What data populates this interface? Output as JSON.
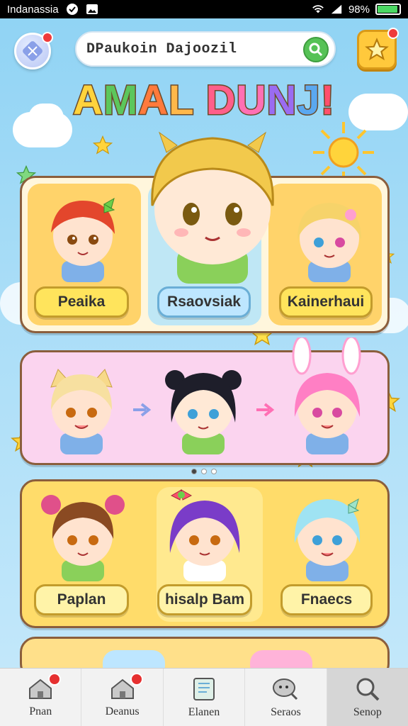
{
  "status_bar": {
    "carrier": "Indanassia",
    "battery_text": "98%",
    "icons": [
      "check-circle-icon",
      "image-icon",
      "wifi-icon",
      "signal-icon",
      "battery-icon"
    ]
  },
  "header": {
    "search_value": "DPaukoin Dajoozil",
    "search_icon": "search-icon",
    "avatar_icon": "avatar-icon",
    "reward_icon": "star-icon"
  },
  "title": {
    "letters": [
      "A",
      "M",
      "A",
      "L",
      " ",
      "D",
      "U",
      "N",
      "J",
      "!"
    ]
  },
  "panel_top": {
    "characters": [
      {
        "label": "Peaika"
      },
      {
        "label": "Rsaovsiak"
      },
      {
        "label": "Kainerhaui"
      }
    ]
  },
  "panel_middle": {
    "characters": [
      "character-blonde-cat",
      "character-black-hair",
      "character-pink-bunny"
    ],
    "page_indicator": {
      "count": 3,
      "active": 0
    }
  },
  "panel_bottom": {
    "characters": [
      {
        "label": "Paplan"
      },
      {
        "label": "hisalp Bam"
      },
      {
        "label": "Fnaecs"
      }
    ]
  },
  "bottom_nav": {
    "items": [
      {
        "label": "Pnan",
        "icon": "home-icon",
        "badge": true
      },
      {
        "label": "Deanus",
        "icon": "home-icon",
        "badge": true
      },
      {
        "label": "Elanen",
        "icon": "book-icon",
        "badge": false
      },
      {
        "label": "Seraos",
        "icon": "chat-search-icon",
        "badge": false
      },
      {
        "label": "Senop",
        "icon": "search-icon",
        "badge": false
      }
    ],
    "active_index": 4
  },
  "colors": {
    "sky": "#8fd3f4",
    "panel_border": "#8b5e3c",
    "chip_yellow": "#ffe45c",
    "chip_blue": "#bde6ff",
    "badge_red": "#ef3b3b"
  }
}
